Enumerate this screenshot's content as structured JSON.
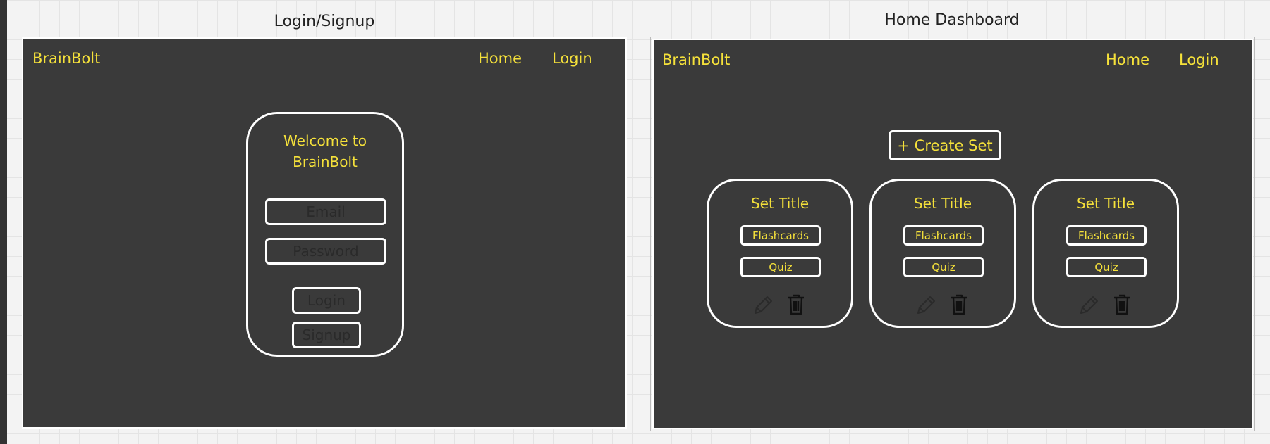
{
  "frames": {
    "login_label": "Login/Signup",
    "dashboard_label": "Home Dashboard"
  },
  "login_screen": {
    "brand": "BrainBolt",
    "nav": {
      "home": "Home",
      "login": "Login"
    },
    "welcome_line1": "Welcome to",
    "welcome_line2": "BrainBolt",
    "email_placeholder": "Email",
    "password_placeholder": "Password",
    "login_button": "Login",
    "signup_button": "Signup"
  },
  "dashboard_screen": {
    "brand": "BrainBolt",
    "nav": {
      "home": "Home",
      "login": "Login"
    },
    "create_button": "+ Create Set",
    "sets": [
      {
        "title": "Set Title",
        "flashcards": "Flashcards",
        "quiz": "Quiz"
      },
      {
        "title": "Set Title",
        "flashcards": "Flashcards",
        "quiz": "Quiz"
      },
      {
        "title": "Set Title",
        "flashcards": "Flashcards",
        "quiz": "Quiz"
      }
    ],
    "icons": [
      "pencil-icon",
      "trash-icon"
    ]
  },
  "colors": {
    "frame_bg": "#3a3a3a",
    "accent_yellow": "#f5e13a",
    "outline": "#ffffff",
    "canvas": "#f3f3f3"
  }
}
